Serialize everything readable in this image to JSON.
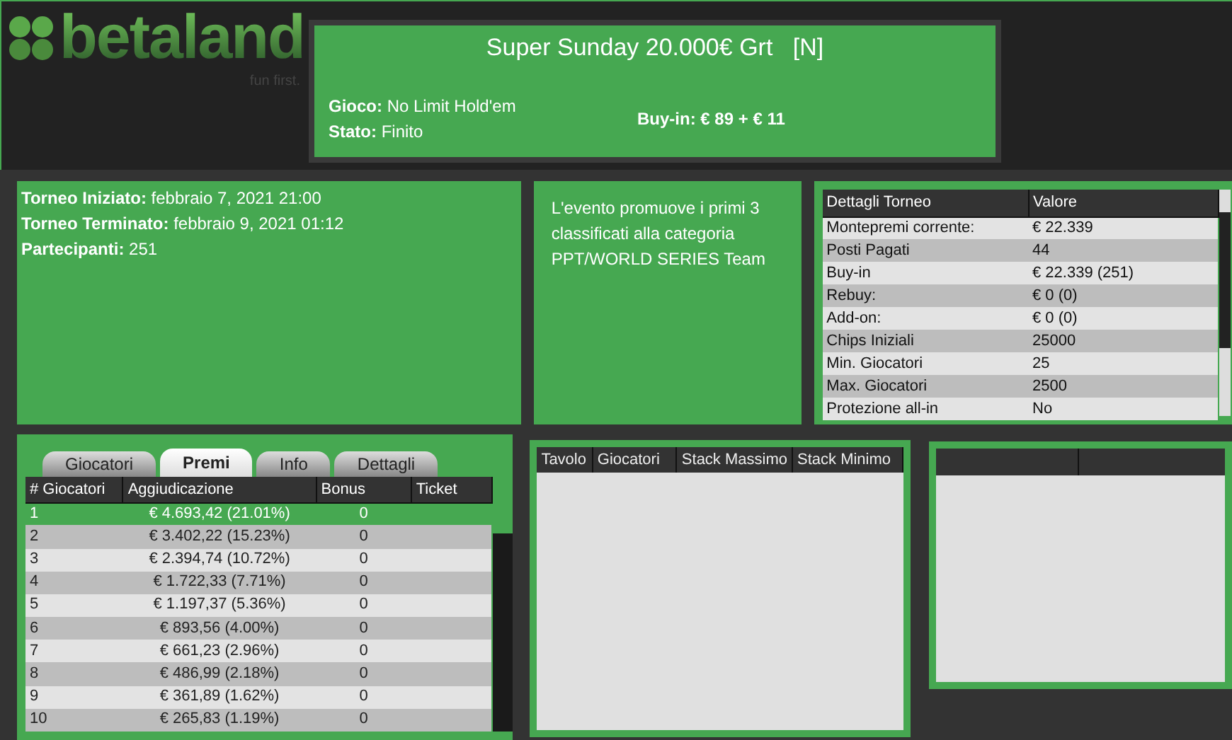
{
  "logo": {
    "text": "betaland",
    "tagline": "fun first."
  },
  "header": {
    "title": "Super Sunday 20.000€ Grt   [N]",
    "fields": [
      {
        "label": "Gioco:",
        "value": "No Limit Hold'em"
      },
      {
        "label": "Stato:",
        "value": "Finito"
      }
    ],
    "buy_in": "Buy-in: € 89 + € 11"
  },
  "info": [
    {
      "label": "Torneo Iniziato:",
      "value": "febbraio 7, 2021 21:00"
    },
    {
      "label": "Torneo Terminato:",
      "value": "febbraio 9, 2021 01:12"
    },
    {
      "label": "Partecipanti:",
      "value": "251"
    }
  ],
  "description": "L'evento promuove i primi 3 classificati alla categoria PPT/WORLD SERIES Team",
  "details_table": {
    "columns": [
      "Dettagli Torneo",
      "Valore"
    ],
    "rows": [
      [
        "Montepremi corrente:",
        "€ 22.339"
      ],
      [
        "Posti Pagati",
        "44"
      ],
      [
        "Buy-in",
        "€ 22.339 (251)"
      ],
      [
        "Rebuy:",
        "€ 0 (0)"
      ],
      [
        "Add-on:",
        "€ 0 (0)"
      ],
      [
        "Chips Iniziali",
        "25000"
      ],
      [
        "Min. Giocatori",
        "25"
      ],
      [
        "Max. Giocatori",
        "2500"
      ],
      [
        "Protezione all-in",
        "No"
      ]
    ]
  },
  "prizes": {
    "tabs": [
      {
        "label": "Giocatori",
        "selected": false
      },
      {
        "label": "Premi",
        "selected": true
      },
      {
        "label": "Info",
        "selected": false
      },
      {
        "label": "Dettagli",
        "selected": false
      }
    ],
    "columns": [
      "# Giocatori",
      "Aggiudicazione",
      "Bonus",
      "Ticket"
    ],
    "rows": [
      {
        "cells": [
          "1",
          "€ 4.693,42 (21.01%)",
          "0"
        ],
        "selected": true
      },
      {
        "cells": [
          "2",
          "€ 3.402,22 (15.23%)",
          "0"
        ],
        "selected": false
      },
      {
        "cells": [
          "3",
          "€ 2.394,74 (10.72%)",
          "0"
        ],
        "selected": false
      },
      {
        "cells": [
          "4",
          "€ 1.722,33 (7.71%)",
          "0"
        ],
        "selected": false
      },
      {
        "cells": [
          "5",
          "€ 1.197,37 (5.36%)",
          "0"
        ],
        "selected": false
      },
      {
        "cells": [
          "6",
          "€ 893,56 (4.00%)",
          "0"
        ],
        "selected": false
      },
      {
        "cells": [
          "7",
          "€ 661,23 (2.96%)",
          "0"
        ],
        "selected": false
      },
      {
        "cells": [
          "8",
          "€ 486,99 (2.18%)",
          "0"
        ],
        "selected": false
      },
      {
        "cells": [
          "9",
          "€ 361,89 (1.62%)",
          "0"
        ],
        "selected": false
      },
      {
        "cells": [
          "10",
          "€ 265,83 (1.19%)",
          "0"
        ],
        "selected": false
      }
    ]
  },
  "tables_list": {
    "columns": [
      "Tavolo",
      "Giocatori",
      "Stack Massimo",
      "Stack Minimo"
    ]
  }
}
